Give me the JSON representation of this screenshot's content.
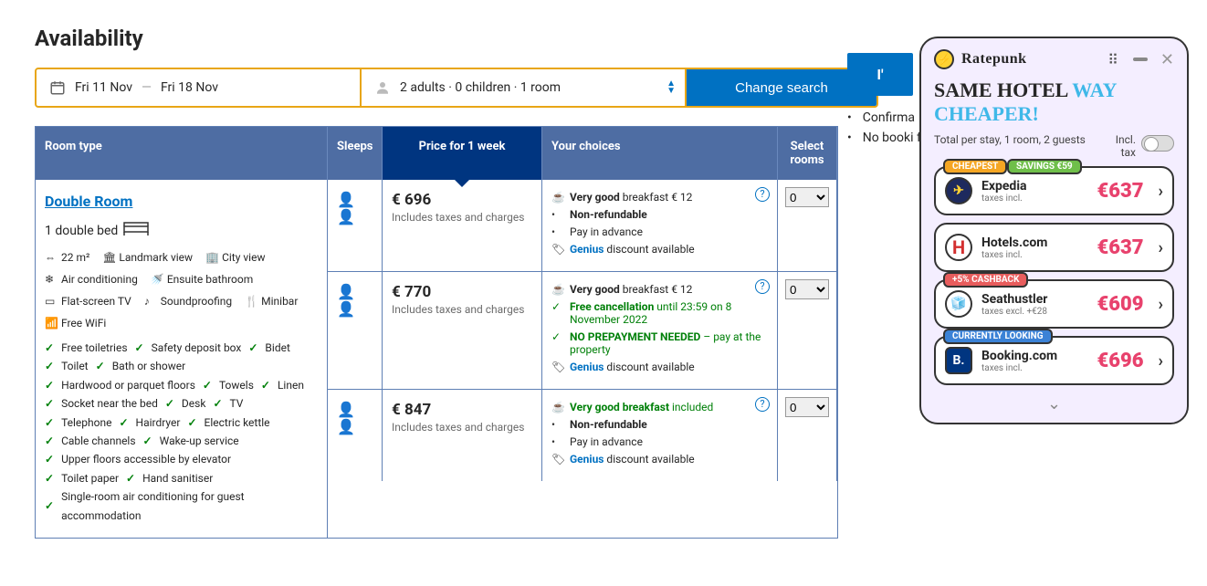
{
  "availability_title": "Availability",
  "dates": {
    "checkin": "Fri 11 Nov",
    "checkout": "Fri 18 Nov"
  },
  "guests": "2 adults · 0 children · 1 room",
  "change_search": "Change search",
  "thead": {
    "room": "Room type",
    "sleeps": "Sleeps",
    "price": "Price for 1 week",
    "choices": "Your choices",
    "select": "Select rooms"
  },
  "room": {
    "name": "Double Room",
    "bed": "1 double bed",
    "features": [
      "22 m²",
      "Landmark view",
      "City view",
      "Air conditioning",
      "Ensuite bathroom",
      "Flat-screen TV",
      "Soundproofing",
      "Minibar",
      "Free WiFi"
    ],
    "amenities": [
      "Free toiletries",
      "Safety deposit box",
      "Bidet",
      "Toilet",
      "Bath or shower",
      "Hardwood or parquet floors",
      "Towels",
      "Linen",
      "Socket near the bed",
      "Desk",
      "TV",
      "Telephone",
      "Hairdryer",
      "Electric kettle",
      "Cable channels",
      "Wake-up service",
      "Upper floors accessible by elevator",
      "Toilet paper",
      "Hand sanitiser",
      "Single-room air conditioning for guest accommodation"
    ]
  },
  "rows": [
    {
      "price": "€ 696",
      "note": "Includes taxes and charges",
      "select": "0",
      "choices": [
        {
          "icon": "cup",
          "b": "Very good",
          "t": " breakfast € 12"
        },
        {
          "icon": "bullet",
          "b": "Non-refundable",
          "t": ""
        },
        {
          "icon": "bullet",
          "b": "",
          "t": "Pay in advance"
        },
        {
          "icon": "tag",
          "g": "Genius",
          "t": " discount available"
        }
      ]
    },
    {
      "price": "€ 770",
      "note": "Includes taxes and charges",
      "select": "0",
      "choices": [
        {
          "icon": "cup",
          "b": "Very good",
          "t": " breakfast € 12"
        },
        {
          "icon": "check",
          "gb": "Free cancellation",
          "gt": " until 23:59 on 8 November 2022"
        },
        {
          "icon": "check",
          "gb": "NO PREPAYMENT NEEDED",
          "gt": " – pay at the property"
        },
        {
          "icon": "tag",
          "g": "Genius",
          "t": " discount available"
        }
      ]
    },
    {
      "price": "€ 847",
      "note": "Includes taxes and charges",
      "select": "0",
      "choices": [
        {
          "icon": "cup",
          "gb": "Very good breakfast",
          "gt": " included"
        },
        {
          "icon": "bullet",
          "b": "Non-refundable",
          "t": ""
        },
        {
          "icon": "bullet",
          "b": "",
          "t": "Pay in advance"
        },
        {
          "icon": "tag",
          "g": "Genius",
          "t": " discount available"
        }
      ]
    }
  ],
  "side": {
    "reserve": "I'",
    "items": [
      "Confirma",
      "No booki fees!"
    ]
  },
  "widget": {
    "brand": "Ratepunk",
    "title_a": "SAME HOTEL ",
    "title_b": "WAY CHEAPER!",
    "sub": "Total per stay, 1 room, 2 guests",
    "incl": "Incl. tax",
    "offers": [
      {
        "name": "Expedia",
        "tax": "taxes incl.",
        "price": "€637",
        "badges": [
          "CHEAPEST",
          "SAVINGS €59"
        ],
        "icon": "exp"
      },
      {
        "name": "Hotels.com",
        "tax": "taxes incl.",
        "price": "€637",
        "badges": [],
        "icon": "hot"
      },
      {
        "name": "Seathustler",
        "tax": "taxes excl. +€28",
        "price": "€609",
        "badges": [
          "+5% CASHBACK"
        ],
        "icon": "seat"
      },
      {
        "name": "Booking.com",
        "tax": "taxes incl.",
        "price": "€696",
        "badges": [
          "CURRENTLY LOOKING"
        ],
        "icon": "book"
      }
    ]
  }
}
